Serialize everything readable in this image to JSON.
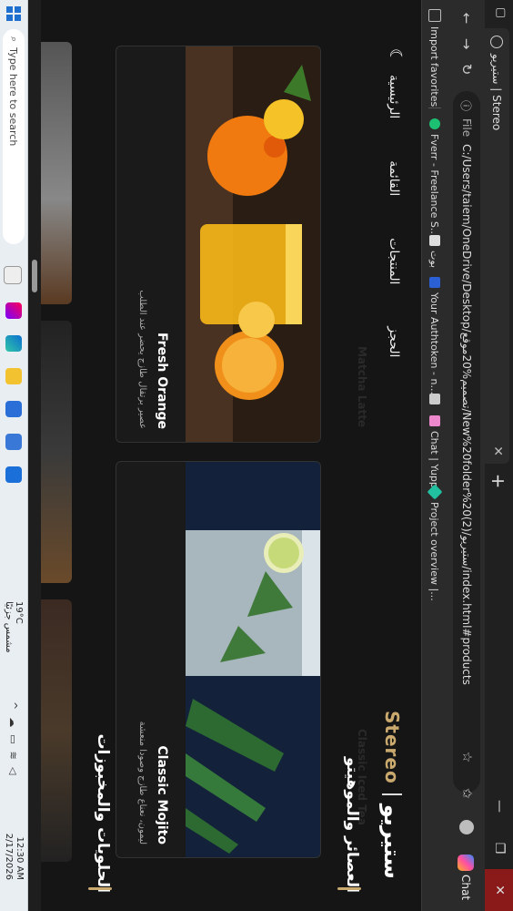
{
  "browser": {
    "tab_title": "ستيريو | Stereo",
    "address_file": "File",
    "address_url": "C:/Users/taiem/OneDrive/Desktop/تصميم%20موقع/New%20folder%20(2)/ستيريو/index.html#products",
    "bookmarks": [
      "Import favorites",
      "Fverr - Freelance S...",
      "بوت",
      "Your Authtoken - n...",
      "📋",
      "Chat | Yupp",
      "Project overview |..."
    ],
    "copilot_label": "Chat"
  },
  "site": {
    "brand_ar": "ستيريو",
    "brand_en": "Stereo",
    "menu": [
      "الرئيسية",
      "القائمة",
      "المنتجات",
      "الحجز"
    ],
    "section1_title": "العصائر والموهيتو",
    "ghost_left": "Matcha Latte",
    "ghost_right": "Classic Iced Tea",
    "cards": [
      {
        "name": "Classic Mojito",
        "desc": "ليمون، نعناع طازج وصودا منعشة"
      },
      {
        "name": "Fresh Orange",
        "desc": "عصير برتقال طازج يحضر عند الطلب"
      }
    ],
    "section2_title": "الحلويات والمخبوزات"
  },
  "taskbar": {
    "search_placeholder": "Type here to search",
    "weather_temp": "19°C",
    "weather_desc": "مشمس جزئيًا",
    "time": "12:30 AM",
    "date": "2/17/2026"
  }
}
